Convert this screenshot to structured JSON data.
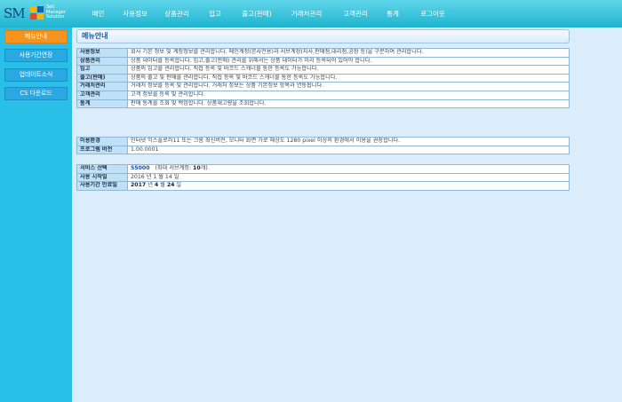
{
  "logo": {
    "mark": "SM",
    "line1": "Sell",
    "line2": "Manager",
    "line3": "Solution"
  },
  "nav": [
    "메인",
    "사용정보",
    "상품관리",
    "입고",
    "출고(판매)",
    "거래처관리",
    "고객관리",
    "통계",
    "로그아웃"
  ],
  "sidebar": [
    "메뉴안내",
    "사용기간연장",
    "업데이트소식",
    "CS 다운로드"
  ],
  "main": {
    "title": "메뉴안내",
    "menu_rows": [
      {
        "k": "사용정보",
        "v": "회사 기본 정보 및 계정정보를 관리합니다. 메인계정(본사전용)과 서브계정(지사,판매점,대리점,공장 등)을 구분하여 관리합니다."
      },
      {
        "k": "상품관리",
        "v": "상품 데이터를 등록합니다. 입고,출고(판매) 관리를 위해서는 상품 데이터가 미리 등록되어 있어야 합니다."
      },
      {
        "k": "입고",
        "v": "상품의 입고를 관리합니다. 직접 등록 및 바코드 스캐너를 통한 등록도 가능합니다."
      },
      {
        "k": "출고(판매)",
        "v": "상품의 출고 및 판매를 관리합니다. 직접 등록 및 바코드 스캐너를 통한 등록도 가능합니다."
      },
      {
        "k": "거래처관리",
        "v": "거래처 정보를 등록 및 관리합니다. 거래처 정보는 상품 기본정보 항목과 연동됩니다."
      },
      {
        "k": "고객관리",
        "v": "고객 정보를 등록 및 관리합니다."
      },
      {
        "k": "통계",
        "v": "판매 통계를 조회 및 백업합니다. 상품재고량을 조회합니다."
      }
    ],
    "env_rows": [
      {
        "k": "이용환경",
        "v": "인터넷 익스플로러11 또는 크롬 최신버전, 모니터 화면 가로 해상도 1280 pixel 이상의 환경에서 이용을 권장합니다."
      },
      {
        "k": "프로그램 버전",
        "v": "1.00.0001"
      }
    ],
    "service": {
      "label_plan": "서비스 선택",
      "plan_value": "55000",
      "plan_note_pre": "(최대 서브계정: ",
      "plan_note_num": "10",
      "plan_note_post": "개)",
      "label_start": "사용 시작일",
      "start_value": "2016 년 1 월 14 일",
      "label_end": "사용기간 만료일",
      "end_year": "2017",
      "end_mid1": " 년 ",
      "end_month": "4",
      "end_mid2": " 월 ",
      "end_day": "24",
      "end_post": " 일"
    }
  },
  "colors": {
    "topbar": "#1fb4cf",
    "sidebar": "#29bfe7",
    "active": "#f7941d",
    "bg": "#dbedfa",
    "header_cell": "#bfe0f5"
  }
}
